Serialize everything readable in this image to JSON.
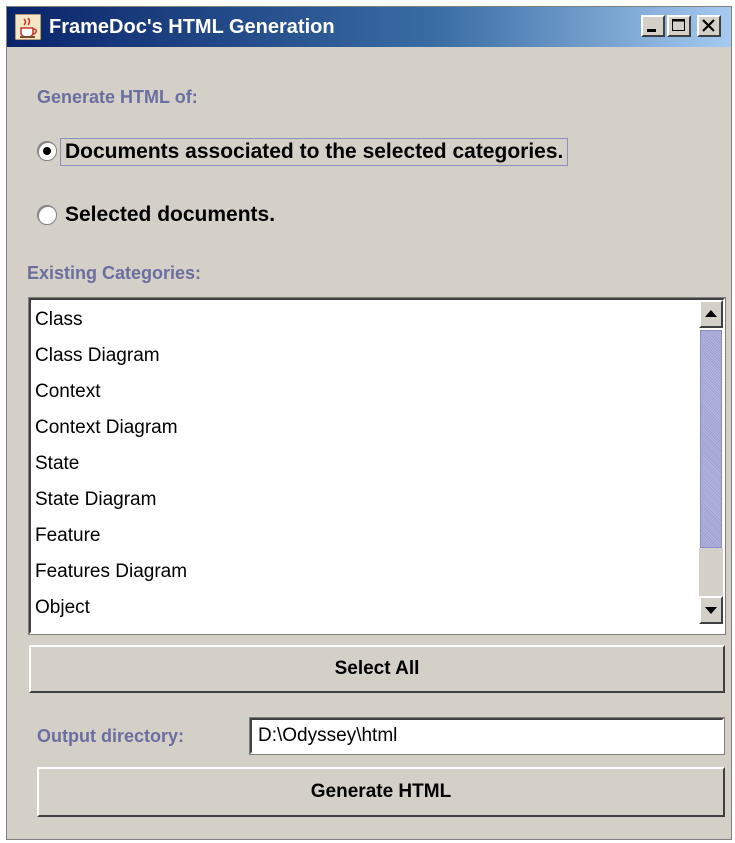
{
  "window": {
    "title": "FrameDoc's HTML Generation",
    "app_icon": "java-coffee-cup-icon"
  },
  "generate": {
    "heading": "Generate HTML of:",
    "options": [
      {
        "label": "Documents associated to the selected categories.",
        "selected": true
      },
      {
        "label": "Selected documents.",
        "selected": false
      }
    ]
  },
  "categories": {
    "heading": "Existing Categories:",
    "items": [
      "Class",
      "Class Diagram",
      "Context",
      "Context Diagram",
      "State",
      "State Diagram",
      "Feature",
      "Features Diagram",
      "Object"
    ]
  },
  "buttons": {
    "select_all": "Select All",
    "generate": "Generate HTML"
  },
  "output": {
    "label": "Output directory:",
    "value": "D:\\Odyssey\\html"
  },
  "colors": {
    "label_purple": "#6b6ea0",
    "window_bg": "#d4d0c8",
    "scroll_thumb": "#a6a9d6"
  }
}
